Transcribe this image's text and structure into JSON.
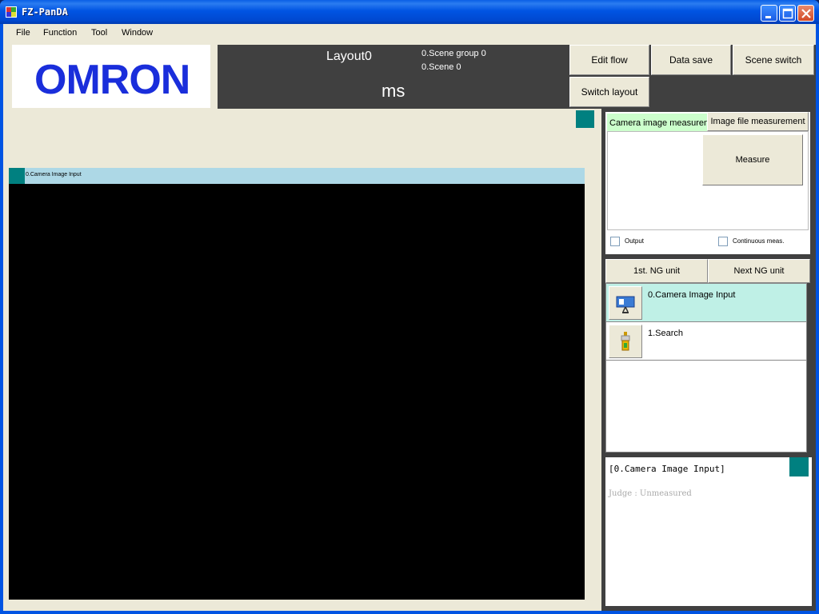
{
  "window": {
    "title": "FZ-PanDA",
    "icons": [
      "app-icon",
      "minimize-icon",
      "maximize-icon",
      "close-icon"
    ]
  },
  "menu": [
    "File",
    "Function",
    "Tool",
    "Window"
  ],
  "header": {
    "logo_text": "OMRON",
    "layout_name": "Layout0",
    "scene_group": "0.Scene group 0",
    "scene": "0.Scene 0",
    "time_unit": "ms",
    "buttons": {
      "edit_flow": "Edit flow",
      "data_save": "Data save",
      "scene_switch": "Scene switch",
      "switch_layout": "Switch layout"
    }
  },
  "image_window": {
    "label": "0.Camera Image Input"
  },
  "measure_panel": {
    "tab_camera": "Camera image measurement",
    "tab_file": "Image file measurement",
    "measure_button": "Measure",
    "output_label": "Output",
    "continuous_label": "Continuous meas."
  },
  "flow": {
    "first_ng": "1st. NG unit",
    "next_ng": "Next NG unit",
    "items": [
      {
        "label": "0.Camera Image Input",
        "icon": "camera-icon",
        "selected": true
      },
      {
        "label": "1.Search",
        "icon": "search-unit-icon",
        "selected": false
      }
    ]
  },
  "result": {
    "title": "[0.Camera Image Input]",
    "judge": "Judge : Unmeasured"
  },
  "colors": {
    "titlebar": "#0054e3",
    "logo": "#1a2edb",
    "dark_panel": "#404040",
    "teal": "#008080",
    "selected_row": "#bff0e6",
    "camera_bar": "#add8e6",
    "camera_tab": "#ccffcc"
  }
}
